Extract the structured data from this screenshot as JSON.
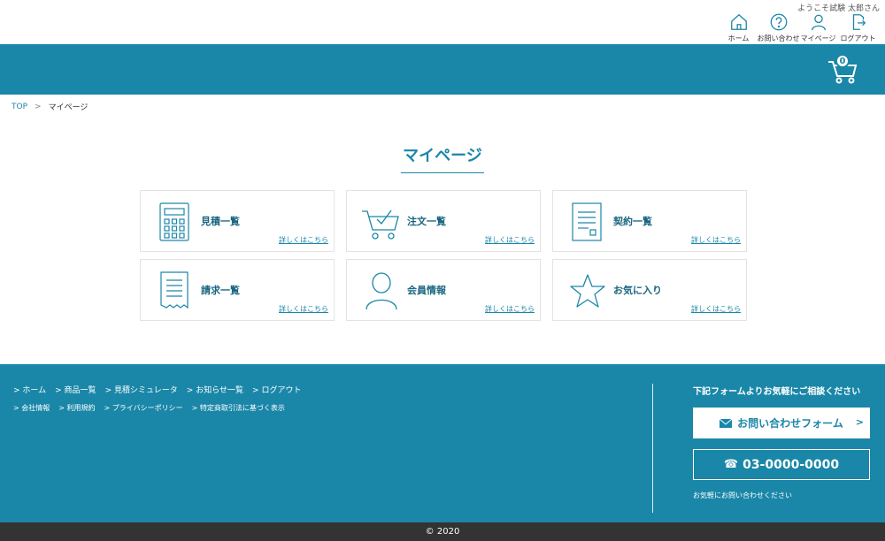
{
  "header": {
    "welcome": "ようこそ試験 太郎さん",
    "nav": [
      {
        "label": "ホーム",
        "icon": "home-icon"
      },
      {
        "label": "お問い合わせ",
        "icon": "help-icon"
      },
      {
        "label": "マイページ",
        "icon": "user-icon"
      },
      {
        "label": "ログアウト",
        "icon": "logout-icon"
      }
    ],
    "cart_count": "0"
  },
  "breadcrumb": {
    "top": "TOP",
    "current": "マイページ"
  },
  "page_title": "マイページ",
  "cards": [
    {
      "title": "見積一覧",
      "link": "詳しくはこちら",
      "icon": "calculator-icon"
    },
    {
      "title": "注文一覧",
      "link": "詳しくはこちら",
      "icon": "cart-check-icon"
    },
    {
      "title": "契約一覧",
      "link": "詳しくはこちら",
      "icon": "contract-document-icon"
    },
    {
      "title": "請求一覧",
      "link": "詳しくはこちら",
      "icon": "invoice-receipt-icon"
    },
    {
      "title": "会員情報",
      "link": "詳しくはこちら",
      "icon": "member-person-icon"
    },
    {
      "title": "お気に入り",
      "link": "詳しくはこちら",
      "icon": "star-icon"
    }
  ],
  "footer": {
    "links_row1": [
      "ホーム",
      "商品一覧",
      "見積シミュレータ",
      "お知らせ一覧",
      "ログアウト"
    ],
    "links_row2": [
      "会社情報",
      "利用規約",
      "プライバシーポリシー",
      "特定商取引法に基づく表示"
    ],
    "consult_title": "下記フォームよりお気軽にご相談ください",
    "form_button": "お問い合わせフォーム",
    "tel": "03-0000-0000",
    "note": "お気軽にお問い合わせください"
  },
  "copyright": "© 2020",
  "colors": {
    "brand": "#1a87a8",
    "footer_bottom": "#333333"
  }
}
